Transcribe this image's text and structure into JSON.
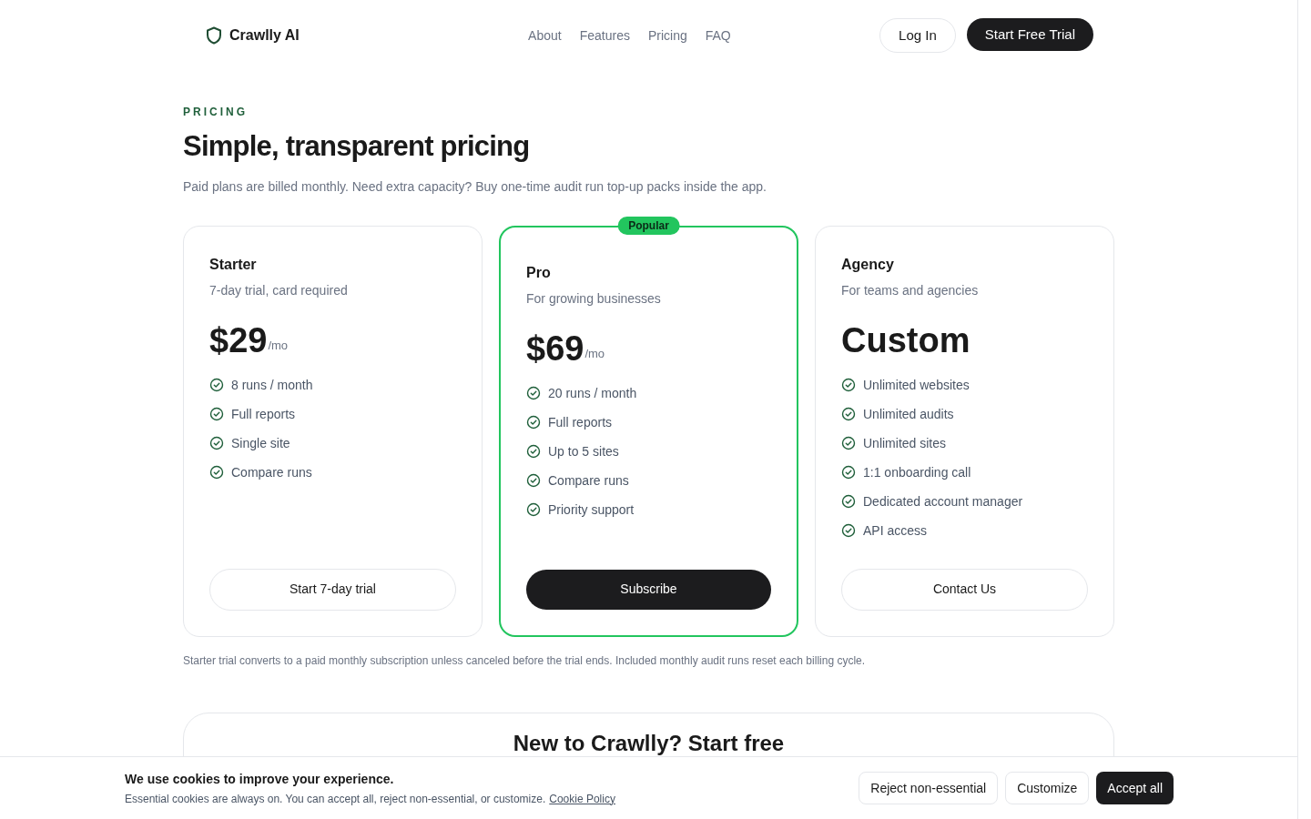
{
  "header": {
    "brand": "Crawlly AI",
    "nav": [
      "About",
      "Features",
      "Pricing",
      "FAQ"
    ],
    "login": "Log In",
    "cta": "Start Free Trial"
  },
  "hero": {
    "eyebrow": "PRICING",
    "title": "Simple, transparent pricing",
    "subtitle": "Paid plans are billed monthly. Need extra capacity? Buy one-time audit run top-up packs inside the app."
  },
  "plans": [
    {
      "name": "Starter",
      "tagline": "7-day trial, card required",
      "price": "$29",
      "period": "/mo",
      "features": [
        "8 runs / month",
        "Full reports",
        "Single site",
        "Compare runs"
      ],
      "button": "Start 7-day trial",
      "highlighted": false
    },
    {
      "name": "Pro",
      "tagline": "For growing businesses",
      "price": "$69",
      "period": "/mo",
      "features": [
        "20 runs / month",
        "Full reports",
        "Up to 5 sites",
        "Compare runs",
        "Priority support"
      ],
      "button": "Subscribe",
      "highlighted": true,
      "badge": "Popular"
    },
    {
      "name": "Agency",
      "tagline": "For teams and agencies",
      "price": "Custom",
      "features": [
        "Unlimited websites",
        "Unlimited audits",
        "Unlimited sites",
        "1:1 onboarding call",
        "Dedicated account manager",
        "API access"
      ],
      "button": "Contact Us",
      "highlighted": false
    }
  ],
  "footnote": "Starter trial converts to a paid monthly subscription unless canceled before the trial ends. Included monthly audit runs reset each billing cycle.",
  "cta_card": {
    "title": "New to Crawlly? Start free"
  },
  "cookie_banner": {
    "title": "We use cookies to improve your experience.",
    "text": "Essential cookies are always on. You can accept all, reject non-essential, or customize.",
    "link": "Cookie Policy",
    "buttons": [
      {
        "label": "Reject non-essential",
        "kind": "outline"
      },
      {
        "label": "Customize",
        "kind": "outline"
      },
      {
        "label": "Accept all",
        "kind": "primary"
      }
    ]
  }
}
